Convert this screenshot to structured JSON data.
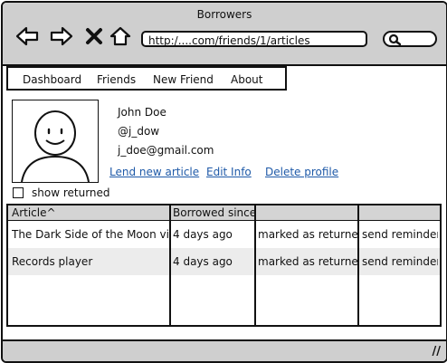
{
  "window": {
    "title": "Borrowers"
  },
  "toolbar": {
    "back_icon": "back-arrow-icon",
    "forward_icon": "forward-arrow-icon",
    "stop_icon": "stop-x-icon",
    "home_icon": "home-icon",
    "url": "http:/....com/friends/1/articles",
    "search_icon": "search-icon"
  },
  "menu": {
    "items": [
      {
        "label": "Dashboard"
      },
      {
        "label": "Friends"
      },
      {
        "label": "New Friend"
      },
      {
        "label": "About"
      }
    ]
  },
  "profile": {
    "name": "John Doe",
    "handle": "@j_dow",
    "email": "j_doe@gmail.com",
    "links": {
      "lend": "Lend new article",
      "edit": "Edit Info",
      "delete": "Delete profile"
    },
    "link_color": "#1f5aa8"
  },
  "filter": {
    "show_returned_label": "show returned",
    "show_returned_checked": false
  },
  "table": {
    "headers": [
      "Article^",
      "Borrowed since",
      "",
      ""
    ],
    "rows": [
      [
        "The Dark Side of the Moon vinyl",
        "4 days ago",
        "marked as returned",
        "send reminder"
      ],
      [
        "Records player",
        "4 days ago",
        "marked as returned",
        "send reminder"
      ]
    ]
  },
  "colors": {
    "chrome": "#cfcfcf",
    "header": "#d4d4d4",
    "alt_row": "#ececec"
  }
}
